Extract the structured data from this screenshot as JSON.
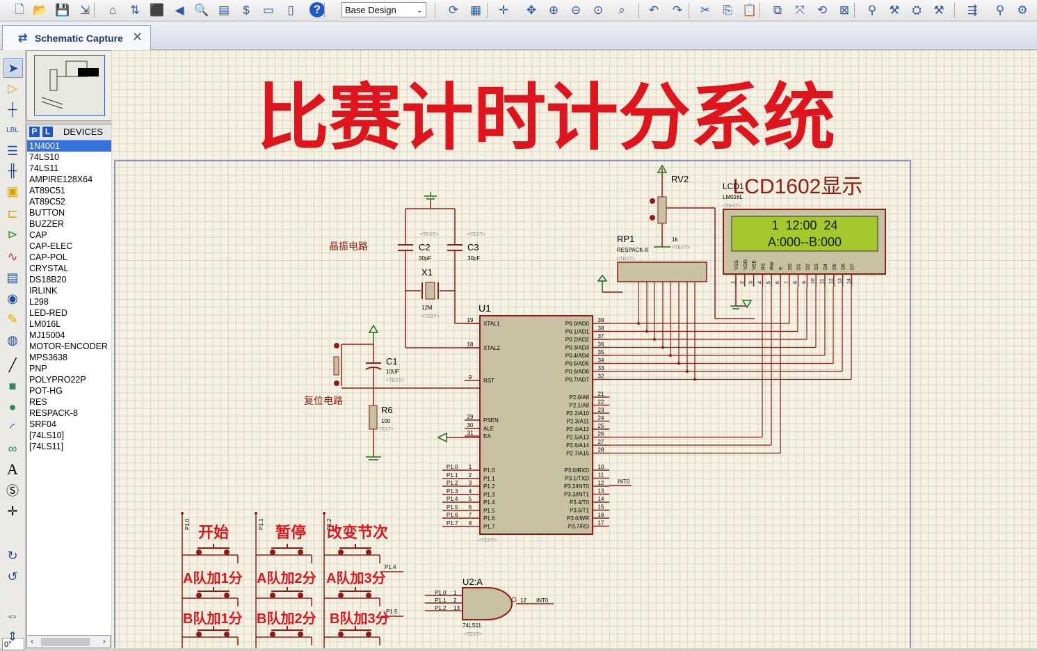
{
  "toolbar": {
    "design_select": "Base Design",
    "icons": [
      "new-file-icon",
      "open-folder-icon",
      "save-icon",
      "import-icon",
      "home-icon",
      "source-icon",
      "chip-icon",
      "back-icon",
      "zoom-find-icon",
      "bill-icon",
      "dollar-icon",
      "binary-icon",
      "document-icon",
      "help-icon",
      "refresh-icon",
      "grid-icon",
      "origin-icon",
      "pan-icon",
      "zoom-in-icon",
      "zoom-out-icon",
      "zoom-all-icon",
      "zoom-area-icon",
      "undo-icon",
      "redo-icon",
      "cut-icon",
      "copy-icon",
      "paste-icon",
      "block-copy-icon",
      "block-move-icon",
      "block-rotate-icon",
      "block-delete-icon",
      "pick-device-icon",
      "make-device-icon",
      "package-icon",
      "decompose-icon",
      "wire-autoroute-icon",
      "search-icon",
      "property-tool-icon"
    ],
    "help_glyph": "?"
  },
  "tab": {
    "label": "Schematic Capture",
    "close": "✕"
  },
  "panel": {
    "p_button": "P",
    "l_button": "L",
    "title": "DEVICES",
    "devices": [
      "1N4001",
      "74LS10",
      "74LS11",
      "AMPIRE128X64",
      "AT89C51",
      "AT89C52",
      "BUTTON",
      "BUZZER",
      "CAP",
      "CAP-ELEC",
      "CAP-POL",
      "CRYSTAL",
      "DS18B20",
      "IRLINK",
      "L298",
      "LED-RED",
      "LM016L",
      "MJ15004",
      "MOTOR-ENCODER",
      "MPS3638",
      "PNP",
      "POLYPRO22P",
      "POT-HG",
      "RES",
      "RESPACK-8",
      "SRF04",
      "[74LS10]",
      "[74LS11]"
    ],
    "selected_index": 0,
    "rotation": "0°"
  },
  "schematic": {
    "banner_title": "比赛计时计分系统",
    "lcd_caption": "LCD1602显示",
    "lcd_ref": "LCD1",
    "lcd_part": "LM016L",
    "lcd_line1": "1  12:00  24",
    "lcd_line2": "A:000--B:000",
    "lcd_pins": [
      "VSS",
      "VDD",
      "VEE",
      "RS",
      "RW",
      "E",
      "D0",
      "D1",
      "D2",
      "D3",
      "D4",
      "D5",
      "D6",
      "D7"
    ],
    "text_placeholder": "<TEXT>",
    "crystal_label": "晶振电路",
    "reset_label": "复位电路",
    "rv2": "RV2",
    "rv2_value": "1k",
    "rp1": "RP1",
    "rp1_part": "RESPACK-8",
    "c2": "C2",
    "c2_val": "30pF",
    "c3": "C3",
    "c3_val": "30pF",
    "x1": "X1",
    "x1_val": "12M",
    "c1": "C1",
    "c1_val": "10UF",
    "r6": "R6",
    "r6_val": "100",
    "u1": "U1",
    "u1_left": [
      {
        "pin": "19",
        "name": "XTAL1"
      },
      {
        "pin": "18",
        "name": "XTAL2"
      },
      {
        "pin": "9",
        "name": "RST"
      },
      {
        "pin": "29",
        "name": "PSEN"
      },
      {
        "pin": "30",
        "name": "ALE"
      },
      {
        "pin": "31",
        "name": "EA"
      },
      {
        "pin": "1",
        "name": "P1.0"
      },
      {
        "pin": "2",
        "name": "P1.1"
      },
      {
        "pin": "3",
        "name": "P1.2"
      },
      {
        "pin": "4",
        "name": "P1.3"
      },
      {
        "pin": "5",
        "name": "P1.4"
      },
      {
        "pin": "6",
        "name": "P1.5"
      },
      {
        "pin": "7",
        "name": "P1.6"
      },
      {
        "pin": "8",
        "name": "P1.7"
      }
    ],
    "u1_right": [
      {
        "pin": "39",
        "name": "P0.0/AD0"
      },
      {
        "pin": "38",
        "name": "P0.1/AD1"
      },
      {
        "pin": "37",
        "name": "P0.2/AD2"
      },
      {
        "pin": "36",
        "name": "P0.3/AD3"
      },
      {
        "pin": "35",
        "name": "P0.4/AD4"
      },
      {
        "pin": "34",
        "name": "P0.5/AD5"
      },
      {
        "pin": "33",
        "name": "P0.6/AD6"
      },
      {
        "pin": "32",
        "name": "P0.7/AD7"
      },
      {
        "pin": "21",
        "name": "P2.0/A8"
      },
      {
        "pin": "22",
        "name": "P2.1/A9"
      },
      {
        "pin": "23",
        "name": "P2.2/A10"
      },
      {
        "pin": "24",
        "name": "P2.3/A11"
      },
      {
        "pin": "25",
        "name": "P2.4/A12"
      },
      {
        "pin": "26",
        "name": "P2.5/A13"
      },
      {
        "pin": "27",
        "name": "P2.6/A14"
      },
      {
        "pin": "28",
        "name": "P2.7/A15"
      },
      {
        "pin": "10",
        "name": "P3.0/RXD"
      },
      {
        "pin": "11",
        "name": "P3.1/TXD"
      },
      {
        "pin": "12",
        "name": "P3.2/INT0"
      },
      {
        "pin": "13",
        "name": "P3.3/INT1"
      },
      {
        "pin": "14",
        "name": "P3.4/T0"
      },
      {
        "pin": "15",
        "name": "P3.5/T1"
      },
      {
        "pin": "16",
        "name": "P3.6/WR"
      },
      {
        "pin": "17",
        "name": "P3.7/RD"
      }
    ],
    "p1_net_labels": [
      "P1.0",
      "P1.1",
      "P1.2",
      "P1.3",
      "P1.4",
      "P1.5",
      "P1.6",
      "P1.7"
    ],
    "int0_label": "INT0",
    "buttons": {
      "start": "开始",
      "pause": "暂停",
      "change": "改变节次",
      "a1": "A队加1分",
      "a2": "A队加2分",
      "a3": "A队加3分",
      "b1": "B队加1分",
      "b2": "B队加2分",
      "b3": "B队加3分"
    },
    "button_nets": [
      "P1.0",
      "P1.1",
      "P1.2",
      "P1.4",
      "P1.5"
    ],
    "u2": "U2:A",
    "u2_part": "74LS11",
    "u2_inputs": [
      "P1.0",
      "P1.1",
      "P1.2"
    ],
    "u2_in_pins": [
      "1",
      "2",
      "13"
    ],
    "u2_out_pin": "12",
    "u2_out_net": "INT0"
  }
}
